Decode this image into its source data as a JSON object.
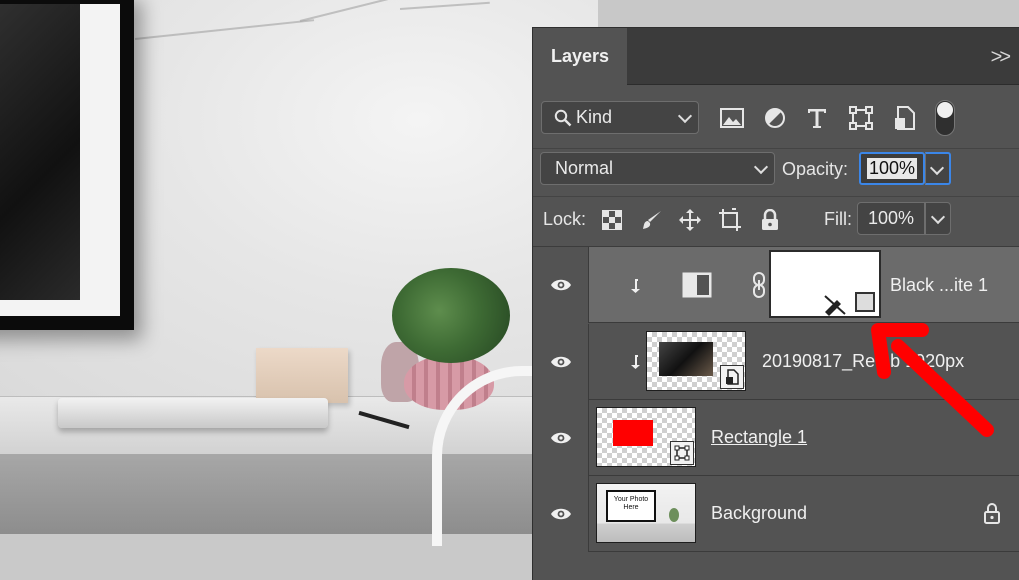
{
  "canvas": {},
  "panel": {
    "tab_label": "Layers",
    "menu_glyph": ">>",
    "filter": {
      "kind_label": "Kind",
      "icons": [
        "image-filter-icon",
        "adjustment-filter-icon",
        "type-filter-icon",
        "shape-filter-icon",
        "smart-object-filter-icon"
      ]
    },
    "blend": {
      "mode": "Normal",
      "opacity_label": "Opacity:",
      "opacity_value": "100%"
    },
    "lock": {
      "label": "Lock:",
      "icons": [
        "lock-transparent-pixels-icon",
        "lock-image-pixels-icon",
        "lock-position-icon",
        "lock-artboard-icon",
        "lock-all-icon"
      ],
      "fill_label": "Fill:",
      "fill_value": "100%"
    },
    "layers": [
      {
        "name": "Black ...ite 1",
        "type": "adjustment",
        "clipped": true,
        "selected": true
      },
      {
        "name": "20190817_Re...b 1920px",
        "type": "smart-object",
        "clipped": true,
        "selected": false
      },
      {
        "name": "Rectangle 1",
        "type": "shape",
        "clipped": false,
        "selected": false,
        "fill_color": "#ff0000"
      },
      {
        "name": "Background",
        "type": "background",
        "clipped": false,
        "selected": false,
        "locked": true,
        "thumb_text": "Your Photo Here"
      }
    ]
  },
  "annotation": {
    "arrow_color": "#ff0000"
  }
}
